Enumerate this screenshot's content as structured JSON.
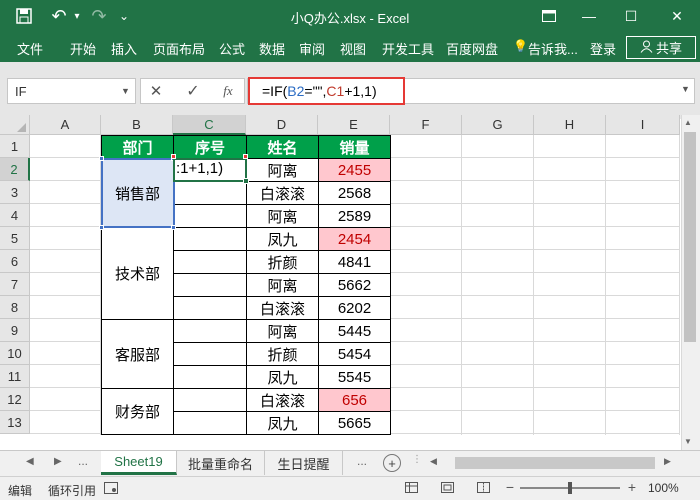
{
  "window": {
    "title": "小Q办公.xlsx - Excel",
    "minimize": "—",
    "restore": "☐",
    "close": "✕",
    "undo_glyph": "↶",
    "redo_glyph": "↷",
    "save_glyph": "💾",
    "qat_more": "⌄"
  },
  "ribbon": {
    "tabs": [
      "文件",
      "开始",
      "插入",
      "页面布局",
      "公式",
      "数据",
      "审阅",
      "视图",
      "开发工具",
      "百度网盘"
    ],
    "tellme": "告诉我...",
    "login": "登录",
    "share": "共享"
  },
  "formula_bar": {
    "name_box": "IF",
    "cancel": "✕",
    "enter": "✓",
    "fx": "fx",
    "formula_parts": {
      "p1": "=IF(",
      "p2": "B2",
      "p3": "=\"\",",
      "p4": "C1",
      "p5": "+1,1)"
    }
  },
  "columns": [
    "A",
    "B",
    "C",
    "D",
    "E",
    "F",
    "G",
    "H",
    "I"
  ],
  "rows": [
    "1",
    "2",
    "3",
    "4",
    "5",
    "6",
    "7",
    "8",
    "9",
    "10",
    "11",
    "12",
    "13"
  ],
  "table": {
    "headers": [
      "部门",
      "序号",
      "姓名",
      "销量"
    ],
    "departments": [
      "销售部",
      "技术部",
      "客服部",
      "财务部"
    ],
    "active_cell_text": ":1+1,1)",
    "records": [
      {
        "name": "阿离",
        "sales": "2455",
        "highlight": true
      },
      {
        "name": "白滚滚",
        "sales": "2568",
        "highlight": false
      },
      {
        "name": "阿离",
        "sales": "2589",
        "highlight": false
      },
      {
        "name": "凤九",
        "sales": "2454",
        "highlight": true
      },
      {
        "name": "折颜",
        "sales": "4841",
        "highlight": false
      },
      {
        "name": "阿离",
        "sales": "5662",
        "highlight": false
      },
      {
        "name": "白滚滚",
        "sales": "6202",
        "highlight": false
      },
      {
        "name": "阿离",
        "sales": "5445",
        "highlight": false
      },
      {
        "name": "折颜",
        "sales": "5454",
        "highlight": false
      },
      {
        "name": "凤九",
        "sales": "5545",
        "highlight": false
      },
      {
        "name": "白滚滚",
        "sales": "656",
        "highlight": true
      },
      {
        "name": "凤九",
        "sales": "5665",
        "highlight": false
      }
    ]
  },
  "sheets": {
    "tabs": [
      "Sheet19",
      "批量重命名",
      "生日提醒"
    ],
    "more": "...",
    "add": "+"
  },
  "status": {
    "mode": "编辑",
    "circular": "循环引用",
    "zoom": "100%",
    "minus": "−",
    "plus": "+"
  },
  "colors": {
    "excel_green": "#217346",
    "header_green": "#00a04a",
    "highlight_pink": "#ffc7ce",
    "highlight_red_text": "#c00000",
    "formula_box_red": "#e53935"
  }
}
